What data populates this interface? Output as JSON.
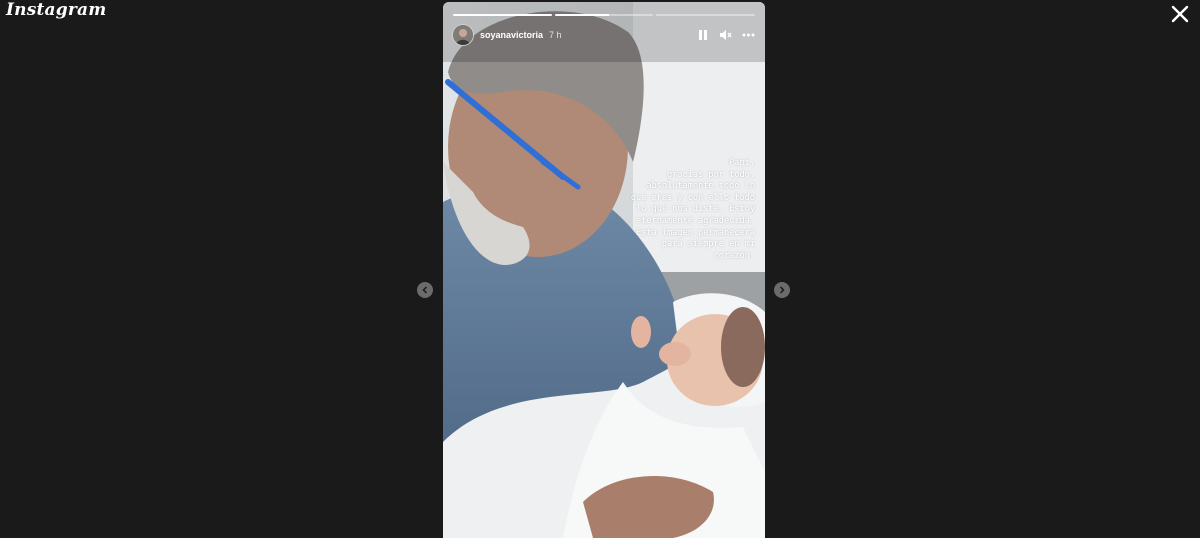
{
  "app": {
    "logo_text": "Instagram"
  },
  "story": {
    "username": "soyanavictoria",
    "timestamp": "7 h",
    "segments": [
      1,
      0.55,
      0
    ],
    "caption": "Papi,\ngracias por todo,\nabsolutamente todo lo\nque eres y con ello todo\nlo que nos diste. Estoy\neternamente agradecida.\nEsta imagen permanecerá\npara siempre en mi\ncorazón."
  },
  "icons": {
    "close": "close-icon",
    "prev": "chevron-left-icon",
    "next": "chevron-right-icon",
    "pause": "pause-icon",
    "mute": "speaker-muted-icon",
    "more": "more-horizontal-icon"
  }
}
